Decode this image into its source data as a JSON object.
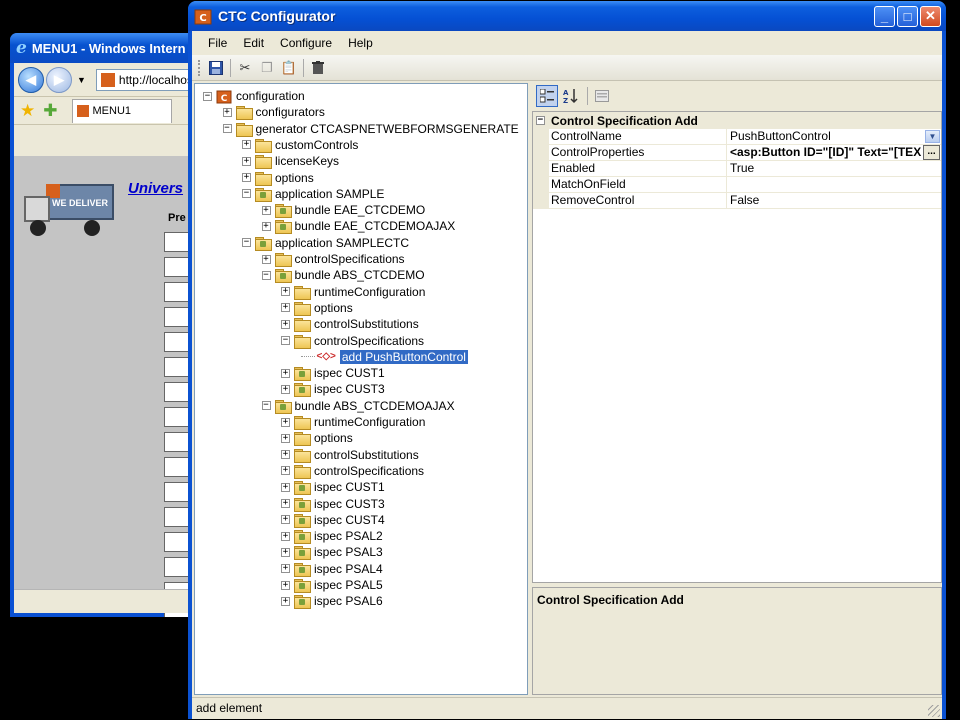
{
  "ie": {
    "title": "MENU1 - Windows Intern",
    "address": "http://localhos",
    "tab_label": "MENU1",
    "page_link": "Univers",
    "page_label": "Pre",
    "truck_text": "WE DELIVER"
  },
  "window": {
    "title": "CTC Configurator",
    "minimize": "_",
    "maximize": "□",
    "close": "✕"
  },
  "menu": {
    "file": "File",
    "edit": "Edit",
    "configure": "Configure",
    "help": "Help"
  },
  "toolbar": {
    "icons": [
      "save-icon",
      "cut-icon",
      "copy-icon",
      "paste-icon",
      "delete-icon"
    ]
  },
  "tree": [
    {
      "label": "configuration",
      "level": 0,
      "expander": "−",
      "icon": "root"
    },
    {
      "label": "configurators",
      "level": 1,
      "expander": "+",
      "icon": "folder"
    },
    {
      "label": "generator CTCASPNETWEBFORMSGENERATE",
      "level": 1,
      "expander": "−",
      "icon": "folder"
    },
    {
      "label": "customControls",
      "level": 2,
      "expander": "+",
      "icon": "folder"
    },
    {
      "label": "licenseKeys",
      "level": 2,
      "expander": "+",
      "icon": "folder"
    },
    {
      "label": "options",
      "level": 2,
      "expander": "+",
      "icon": "folder"
    },
    {
      "label": "application SAMPLE",
      "level": 2,
      "expander": "−",
      "icon": "special"
    },
    {
      "label": "bundle EAE_CTCDEMO",
      "level": 3,
      "expander": "+",
      "icon": "special"
    },
    {
      "label": "bundle EAE_CTCDEMOAJAX",
      "level": 3,
      "expander": "+",
      "icon": "special"
    },
    {
      "label": "application SAMPLECTC",
      "level": 2,
      "expander": "−",
      "icon": "special"
    },
    {
      "label": "controlSpecifications",
      "level": 3,
      "expander": "+",
      "icon": "folder"
    },
    {
      "label": "bundle ABS_CTCDEMO",
      "level": 3,
      "expander": "−",
      "icon": "special"
    },
    {
      "label": "runtimeConfiguration",
      "level": 4,
      "expander": "+",
      "icon": "folder"
    },
    {
      "label": "options",
      "level": 4,
      "expander": "+",
      "icon": "folder"
    },
    {
      "label": "controlSubstitutions",
      "level": 4,
      "expander": "+",
      "icon": "folder"
    },
    {
      "label": "controlSpecifications",
      "level": 4,
      "expander": "−",
      "icon": "folder"
    },
    {
      "label": "add PushButtonControl",
      "level": 5,
      "expander": "",
      "icon": "element",
      "selected": true
    },
    {
      "label": "ispec CUST1",
      "level": 4,
      "expander": "+",
      "icon": "special"
    },
    {
      "label": "ispec CUST3",
      "level": 4,
      "expander": "+",
      "icon": "special"
    },
    {
      "label": "bundle ABS_CTCDEMOAJAX",
      "level": 3,
      "expander": "−",
      "icon": "special"
    },
    {
      "label": "runtimeConfiguration",
      "level": 4,
      "expander": "+",
      "icon": "folder"
    },
    {
      "label": "options",
      "level": 4,
      "expander": "+",
      "icon": "folder"
    },
    {
      "label": "controlSubstitutions",
      "level": 4,
      "expander": "+",
      "icon": "folder"
    },
    {
      "label": "controlSpecifications",
      "level": 4,
      "expander": "+",
      "icon": "folder"
    },
    {
      "label": "ispec CUST1",
      "level": 4,
      "expander": "+",
      "icon": "special"
    },
    {
      "label": "ispec CUST3",
      "level": 4,
      "expander": "+",
      "icon": "special"
    },
    {
      "label": "ispec CUST4",
      "level": 4,
      "expander": "+",
      "icon": "special"
    },
    {
      "label": "ispec PSAL2",
      "level": 4,
      "expander": "+",
      "icon": "special"
    },
    {
      "label": "ispec PSAL3",
      "level": 4,
      "expander": "+",
      "icon": "special"
    },
    {
      "label": "ispec PSAL4",
      "level": 4,
      "expander": "+",
      "icon": "special"
    },
    {
      "label": "ispec PSAL5",
      "level": 4,
      "expander": "+",
      "icon": "special"
    },
    {
      "label": "ispec PSAL6",
      "level": 4,
      "expander": "+",
      "icon": "special"
    }
  ],
  "props": {
    "category": "Control Specification Add",
    "category_expander": "−",
    "rows": [
      {
        "name": "ControlName",
        "value": "PushButtonControl",
        "bold": false,
        "dropdown": true
      },
      {
        "name": "ControlProperties",
        "value": "<asp:Button ID=\"[ID]\" Text=\"[TEX",
        "bold": true,
        "ellipsis": true
      },
      {
        "name": "Enabled",
        "value": "True",
        "bold": false
      },
      {
        "name": "MatchOnField",
        "value": "",
        "bold": false
      },
      {
        "name": "RemoveControl",
        "value": "False",
        "bold": false
      }
    ],
    "description_title": "Control Specification Add",
    "ellipsis_label": "..."
  },
  "status": {
    "text": "add element"
  }
}
